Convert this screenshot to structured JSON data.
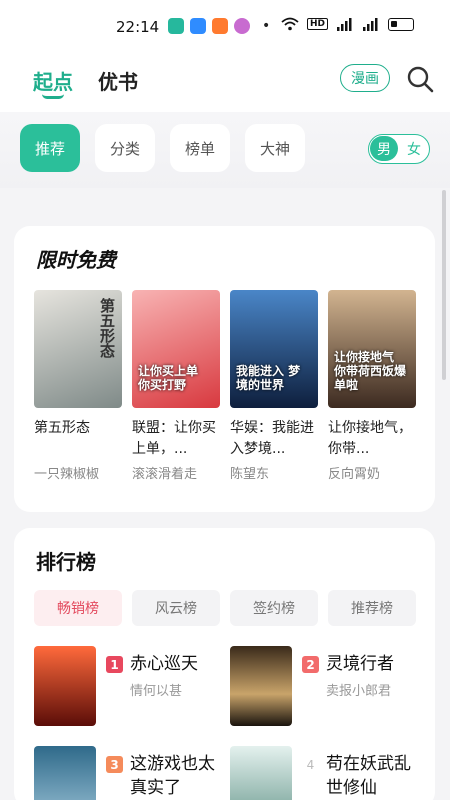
{
  "status_bar": {
    "time": "22:14",
    "network_label": "HD",
    "app_icons": [
      "#26b89d",
      "#2f8cff",
      "#ff7a2f",
      "#c86bd0"
    ],
    "dot": "•"
  },
  "header": {
    "tabs": [
      {
        "label": "起点",
        "active": true
      },
      {
        "label": "优书",
        "active": false
      }
    ],
    "manga_button": "漫画",
    "search_icon": "search-icon",
    "accent_color": "#1fae8c"
  },
  "filters": {
    "chips": [
      "推荐",
      "分类",
      "榜单",
      "大神"
    ],
    "active_index": 0,
    "gender": {
      "male": "男",
      "female": "女",
      "selected": "男"
    }
  },
  "free_section": {
    "title": "限时免费",
    "books": [
      {
        "title": "第五形态",
        "author": "一只辣椒椒",
        "cover_text": "第五形态",
        "cover_colors": [
          "#d9d7d1",
          "#7f8a88"
        ]
      },
      {
        "title": "联盟：让你买上单，...",
        "author": "滚滚滑着走",
        "cover_text": "让你买上单 你买打野",
        "cover_colors": [
          "#f59aa0",
          "#d8393f"
        ]
      },
      {
        "title": "华娱：我能进入梦境...",
        "author": "陈望东",
        "cover_text": "我能进入 梦境的世界",
        "cover_colors": [
          "#3d6fb0",
          "#0e1f3d"
        ]
      },
      {
        "title": "让你接地气，你带...",
        "author": "反向霄奶",
        "cover_text": "让你接地气 你带荷西饭爆单啦",
        "cover_colors": [
          "#c7a684",
          "#3c2a20"
        ]
      }
    ]
  },
  "ranking_section": {
    "title": "排行榜",
    "tabs": [
      "畅销榜",
      "风云榜",
      "签约榜",
      "推荐榜"
    ],
    "active_tab": 0,
    "items": [
      {
        "rank": "1",
        "title": "赤心巡天",
        "author": "情何以甚",
        "cover_colors": [
          "#ff6a3c",
          "#5a0d08"
        ]
      },
      {
        "rank": "2",
        "title": "灵境行者",
        "author": "卖报小郎君",
        "cover_colors": [
          "#f2d9a8",
          "#3a2a1a"
        ]
      },
      {
        "rank": "3",
        "title": "这游戏也太真实了",
        "author": "",
        "cover_colors": [
          "#2f6a8a",
          "#9ec4d8"
        ]
      },
      {
        "rank": "4",
        "title": "苟在妖武乱世修仙",
        "author": "",
        "cover_colors": [
          "#d6ebe6",
          "#6b9a8f"
        ]
      }
    ],
    "rank_colors": [
      "#e8485e",
      "#f26b6b",
      "#f58b5b"
    ]
  }
}
